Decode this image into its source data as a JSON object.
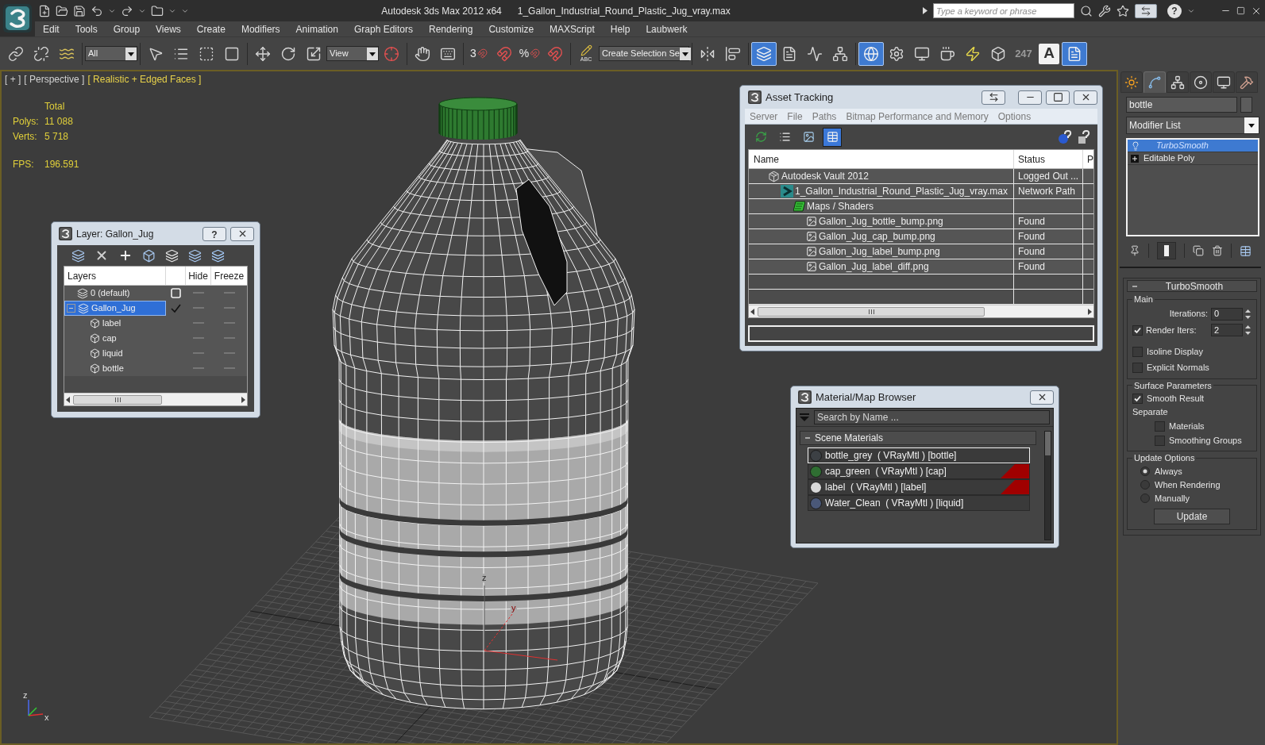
{
  "title_bar": {
    "app_title": "Autodesk 3ds Max 2012 x64",
    "file_name": "1_Gallon_Industrial_Round_Plastic_Jug_vray.max",
    "search": {
      "placeholder": "Type a keyword or phrase"
    },
    "help": "?"
  },
  "menu": [
    "Edit",
    "Tools",
    "Group",
    "Views",
    "Create",
    "Modifiers",
    "Animation",
    "Graph Editors",
    "Rendering",
    "Customize",
    "MAXScript",
    "Help",
    "Laubwerk"
  ],
  "toolbar": {
    "selection_filter": "All",
    "coordinate_system": "View",
    "snap_label": "3",
    "percent_snap_label": "%",
    "named_selection_label": "ABC",
    "named_selection": "Create Selection Se",
    "counter": "247",
    "text_tool": "A",
    "layers_on": true,
    "globe_on": true,
    "document_on": true
  },
  "viewport": {
    "labels": [
      {
        "text": "[ + ]",
        "kind": "menu"
      },
      {
        "text": "[ Perspective ]",
        "kind": "menu"
      },
      {
        "text": "[ Realistic + Edged Faces ]",
        "kind": "shading"
      }
    ],
    "stats": {
      "header": "Total",
      "rows": [
        {
          "label": "Polys:",
          "value": "11 088"
        },
        {
          "label": "Verts:",
          "value": "5 718"
        }
      ],
      "fps_label": "FPS:",
      "fps_value": "196.591"
    },
    "pivot_labels": [
      "z",
      "y"
    ],
    "world_axis_labels": [
      "z",
      "x"
    ]
  },
  "layer_dialog": {
    "title": "Layer: Gallon_Jug",
    "help": "?",
    "columns": [
      "Layers",
      "Hide",
      "Freeze"
    ],
    "layers": [
      {
        "kind": "layer",
        "name": "0 (default)",
        "selected": false,
        "current": false,
        "hidden": false,
        "frozen": false
      },
      {
        "kind": "layer",
        "name": "Gallon_Jug",
        "selected": true,
        "current": true,
        "hidden": false,
        "frozen": false,
        "expanded": true,
        "children": [
          {
            "kind": "object",
            "name": "label",
            "selected": false,
            "hidden": false,
            "frozen": false
          },
          {
            "kind": "object",
            "name": "cap",
            "selected": false,
            "hidden": false,
            "frozen": false
          },
          {
            "kind": "object",
            "name": "liquid",
            "selected": false,
            "hidden": false,
            "frozen": false
          },
          {
            "kind": "object",
            "name": "bottle",
            "selected": false,
            "hidden": false,
            "frozen": false
          }
        ]
      }
    ]
  },
  "asset_tracking": {
    "title": "Asset Tracking",
    "menu": [
      "Server",
      "File",
      "Paths",
      "Bitmap Performance and Memory",
      "Options"
    ],
    "toolbar": [
      {
        "kind": "refresh",
        "selected": false
      },
      {
        "kind": "list",
        "selected": false
      },
      {
        "kind": "thumbnail",
        "selected": false
      },
      {
        "kind": "table",
        "selected": true
      }
    ],
    "columns": [
      "Name",
      "Status",
      "P"
    ],
    "tree": [
      {
        "kind": "vault",
        "name": "Autodesk Vault 2012",
        "status": "Logged Out ...",
        "children": [
          {
            "kind": "scene",
            "name": "1_Gallon_Industrial_Round_Plastic_Jug_vray.max",
            "status": "Network Path",
            "children": [
              {
                "kind": "folder",
                "name": "Maps / Shaders",
                "children": [
                  {
                    "kind": "image",
                    "name": "Gallon_Jug_bottle_bump.png",
                    "status": "Found"
                  },
                  {
                    "kind": "image",
                    "name": "Gallon_Jug_cap_bump.png",
                    "status": "Found"
                  },
                  {
                    "kind": "image",
                    "name": "Gallon_Jug_label_bump.png",
                    "status": "Found"
                  },
                  {
                    "kind": "image",
                    "name": "Gallon_Jug_label_diff.png",
                    "status": "Found"
                  }
                ]
              }
            ]
          }
        ]
      }
    ]
  },
  "material_browser": {
    "title": "Material/Map Browser",
    "search": {
      "placeholder": "Search by Name ..."
    },
    "groups": [
      {
        "name": "Scene Materials",
        "expanded": true,
        "items": [
          {
            "label": "bottle_grey  ( VRayMtl ) [bottle]",
            "color": "#3c4044",
            "selected": true,
            "flagged": false
          },
          {
            "label": "cap_green  ( VRayMtl ) [cap]",
            "color": "#2f6e32",
            "selected": false,
            "flagged": true
          },
          {
            "label": "label  ( VRayMtl ) [label]",
            "color": "#d8d8d8",
            "selected": false,
            "flagged": true
          },
          {
            "label": "Water_Clean  ( VRayMtl ) [liquid]",
            "color": "#4a5878",
            "selected": false,
            "flagged": false
          }
        ]
      }
    ]
  },
  "command_panel": {
    "tabs": [
      {
        "kind": "create",
        "selected": false
      },
      {
        "kind": "modify",
        "selected": true
      },
      {
        "kind": "hierarchy",
        "selected": false
      },
      {
        "kind": "motion",
        "selected": false
      },
      {
        "kind": "display",
        "selected": false
      },
      {
        "kind": "utilities",
        "selected": false
      }
    ],
    "object_name": "bottle",
    "modifier_list": "Modifier List",
    "stack": [
      {
        "kind": "modifier",
        "name": "TurboSmooth",
        "selected": true
      },
      {
        "kind": "base",
        "name": "Editable Poly",
        "selected": false
      }
    ],
    "show_end_result": true,
    "rollout": {
      "title": "TurboSmooth",
      "expanded": true,
      "main": {
        "title": "Main",
        "iterations": {
          "label": "Iterations:",
          "value": "0"
        },
        "render_iters": {
          "label": "Render Iters:",
          "checked": true,
          "value": "2"
        },
        "options": [
          {
            "label": "Isoline Display",
            "checked": false
          },
          {
            "label": "Explicit Normals",
            "checked": false
          }
        ]
      },
      "surface": {
        "title": "Surface Parameters",
        "smooth_result": {
          "label": "Smooth Result",
          "checked": true
        },
        "separate_label": "Separate",
        "separate": [
          {
            "label": "Materials",
            "checked": false
          },
          {
            "label": "Smoothing Groups",
            "checked": false
          }
        ]
      },
      "update": {
        "title": "Update Options",
        "options": [
          {
            "label": "Always",
            "selected": true
          },
          {
            "label": "When Rendering",
            "selected": false
          },
          {
            "label": "Manually",
            "selected": false
          }
        ],
        "button": "Update"
      }
    }
  }
}
